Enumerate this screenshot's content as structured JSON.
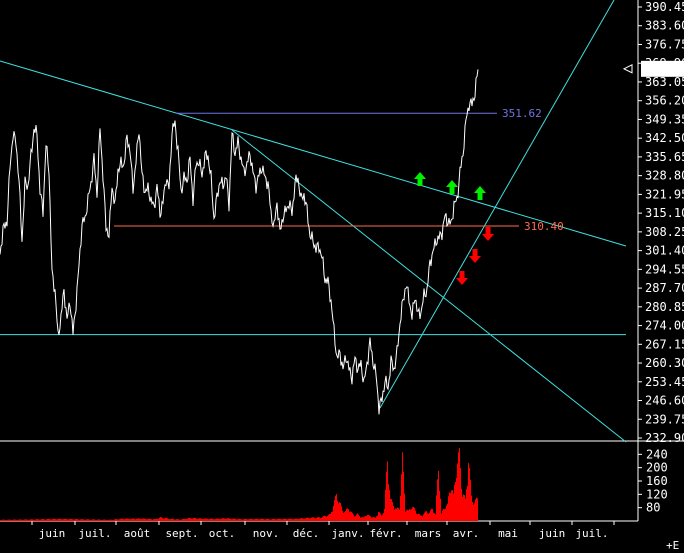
{
  "chart_data": {
    "type": "line",
    "last_price": "367.85",
    "y_ticks": [
      "390.45",
      "383.60",
      "376.75",
      "369.90",
      "363.05",
      "356.20",
      "349.35",
      "342.50",
      "335.65",
      "328.80",
      "321.95",
      "315.10",
      "308.25",
      "301.40",
      "294.55",
      "287.70",
      "280.85",
      "274.00",
      "267.15",
      "260.30",
      "253.45",
      "246.60",
      "239.75",
      "232.90"
    ],
    "ylim": [
      232.9,
      390.45
    ],
    "x_ticks": [
      "juin",
      "juil.",
      "août",
      "sept.",
      "oct.",
      "nov.",
      "déc.",
      "janv.",
      "févr.",
      "mars",
      "avr.",
      "mai",
      "juin",
      "juil."
    ],
    "volume_ticks": [
      "240",
      "200",
      "160",
      "120",
      "80"
    ],
    "volume_ylim": [
      40,
      265
    ],
    "volume_unit": "+E",
    "levels": [
      {
        "label": "351.62",
        "value": 351.62,
        "color": "#6f74e6"
      },
      {
        "label": "310.40",
        "value": 310.4,
        "color": "#ff6a4c"
      },
      {
        "label": "",
        "value": 270.7,
        "color": "#40e0e0"
      }
    ],
    "colors": {
      "price": "#ffffff",
      "trendline": "#40e0e0",
      "volume": "#ff0000",
      "up_arrow": "#00ee00",
      "down_arrow": "#ff0000",
      "axis": "#ffffff"
    },
    "price_anchors": [
      [
        0,
        300
      ],
      [
        3,
        309
      ],
      [
        7,
        312
      ],
      [
        10,
        332
      ],
      [
        13,
        344
      ],
      [
        16,
        341
      ],
      [
        19,
        327
      ],
      [
        22,
        305
      ],
      [
        25,
        326
      ],
      [
        28,
        325
      ],
      [
        31,
        336
      ],
      [
        34,
        346
      ],
      [
        37,
        344
      ],
      [
        40,
        323
      ],
      [
        43,
        316
      ],
      [
        46,
        340
      ],
      [
        49,
        331
      ],
      [
        52,
        293
      ],
      [
        55,
        287
      ],
      [
        58,
        270
      ],
      [
        61,
        277
      ],
      [
        64,
        287
      ],
      [
        67,
        276
      ],
      [
        70,
        283
      ],
      [
        73,
        271
      ],
      [
        76,
        282
      ],
      [
        79,
        296
      ],
      [
        82,
        311
      ],
      [
        85,
        313
      ],
      [
        88,
        320
      ],
      [
        91,
        326
      ],
      [
        94,
        335
      ],
      [
        97,
        322
      ],
      [
        100,
        346
      ],
      [
        103,
        329
      ],
      [
        106,
        310
      ],
      [
        109,
        307
      ],
      [
        112,
        325
      ],
      [
        115,
        318
      ],
      [
        118,
        331
      ],
      [
        121,
        333
      ],
      [
        124,
        333
      ],
      [
        127,
        343
      ],
      [
        130,
        338
      ],
      [
        133,
        324
      ],
      [
        136,
        334
      ],
      [
        139,
        346
      ],
      [
        142,
        329
      ],
      [
        145,
        323
      ],
      [
        148,
        324
      ],
      [
        151,
        320
      ],
      [
        154,
        317
      ],
      [
        157,
        325
      ],
      [
        160,
        315
      ],
      [
        163,
        319
      ],
      [
        166,
        328
      ],
      [
        169,
        324
      ],
      [
        172,
        345
      ],
      [
        175,
        348
      ],
      [
        178,
        338
      ],
      [
        181,
        323
      ],
      [
        184,
        328
      ],
      [
        187,
        327
      ],
      [
        190,
        335
      ],
      [
        193,
        320
      ],
      [
        196,
        333
      ],
      [
        199,
        334
      ],
      [
        202,
        329
      ],
      [
        205,
        336
      ],
      [
        208,
        336
      ],
      [
        211,
        328
      ],
      [
        214,
        313
      ],
      [
        217,
        321
      ],
      [
        220,
        327
      ],
      [
        223,
        325
      ],
      [
        226,
        329
      ],
      [
        229,
        318
      ],
      [
        232,
        344
      ],
      [
        235,
        337
      ],
      [
        238,
        341
      ],
      [
        241,
        335
      ],
      [
        244,
        330
      ],
      [
        247,
        333
      ],
      [
        250,
        337
      ],
      [
        253,
        330
      ],
      [
        256,
        325
      ],
      [
        259,
        329
      ],
      [
        262,
        332
      ],
      [
        265,
        328
      ],
      [
        268,
        326
      ],
      [
        271,
        315
      ],
      [
        274,
        310
      ],
      [
        277,
        319
      ],
      [
        280,
        308
      ],
      [
        283,
        314
      ],
      [
        286,
        316
      ],
      [
        289,
        319
      ],
      [
        292,
        315
      ],
      [
        295,
        326
      ],
      [
        298,
        328
      ],
      [
        301,
        320
      ],
      [
        304,
        322
      ],
      [
        307,
        316
      ],
      [
        310,
        307
      ],
      [
        313,
        305
      ],
      [
        316,
        302
      ],
      [
        319,
        303
      ],
      [
        322,
        299
      ],
      [
        325,
        291
      ],
      [
        328,
        290
      ],
      [
        331,
        283
      ],
      [
        334,
        272
      ],
      [
        337,
        262
      ],
      [
        340,
        264
      ],
      [
        343,
        258
      ],
      [
        346,
        263
      ],
      [
        349,
        258
      ],
      [
        352,
        255
      ],
      [
        355,
        262
      ],
      [
        358,
        258
      ],
      [
        361,
        260
      ],
      [
        364,
        253
      ],
      [
        367,
        260
      ],
      [
        370,
        268
      ],
      [
        373,
        261
      ],
      [
        376,
        256
      ],
      [
        379,
        244
      ],
      [
        382,
        247
      ],
      [
        385,
        254
      ],
      [
        388,
        251
      ],
      [
        391,
        261
      ],
      [
        394,
        258
      ],
      [
        397,
        264
      ],
      [
        400,
        275
      ],
      [
        403,
        283
      ],
      [
        406,
        289
      ],
      [
        409,
        284
      ],
      [
        412,
        277
      ],
      [
        415,
        285
      ],
      [
        418,
        278
      ],
      [
        421,
        279
      ],
      [
        424,
        285
      ],
      [
        427,
        287
      ],
      [
        430,
        297
      ],
      [
        433,
        301
      ],
      [
        436,
        305
      ],
      [
        439,
        306
      ],
      [
        442,
        308
      ],
      [
        445,
        314
      ],
      [
        448,
        312
      ],
      [
        451,
        311
      ],
      [
        454,
        318
      ],
      [
        457,
        320
      ],
      [
        460,
        330
      ],
      [
        463,
        337
      ],
      [
        466,
        349
      ],
      [
        469,
        355
      ],
      [
        472,
        355
      ],
      [
        475,
        359
      ],
      [
        478,
        368
      ]
    ],
    "volume_anchors": [
      [
        0,
        44
      ],
      [
        30,
        45
      ],
      [
        60,
        47
      ],
      [
        90,
        45
      ],
      [
        110,
        44
      ],
      [
        120,
        47
      ],
      [
        140,
        48
      ],
      [
        155,
        46
      ],
      [
        160,
        52
      ],
      [
        170,
        47
      ],
      [
        180,
        45
      ],
      [
        190,
        50
      ],
      [
        200,
        48
      ],
      [
        215,
        47
      ],
      [
        225,
        49
      ],
      [
        240,
        46
      ],
      [
        260,
        47
      ],
      [
        270,
        46
      ],
      [
        280,
        47
      ],
      [
        295,
        47
      ],
      [
        310,
        51
      ],
      [
        320,
        52
      ],
      [
        330,
        62
      ],
      [
        333,
        93
      ],
      [
        336,
        128
      ],
      [
        339,
        103
      ],
      [
        342,
        76
      ],
      [
        345,
        72
      ],
      [
        348,
        84
      ],
      [
        351,
        68
      ],
      [
        354,
        58
      ],
      [
        357,
        63
      ],
      [
        360,
        55
      ],
      [
        363,
        51
      ],
      [
        366,
        62
      ],
      [
        369,
        57
      ],
      [
        372,
        54
      ],
      [
        375,
        50
      ],
      [
        378,
        72
      ],
      [
        381,
        58
      ],
      [
        384,
        80
      ],
      [
        387,
        246
      ],
      [
        390,
        110
      ],
      [
        393,
        96
      ],
      [
        396,
        78
      ],
      [
        399,
        86
      ],
      [
        402,
        247
      ],
      [
        405,
        82
      ],
      [
        408,
        72
      ],
      [
        411,
        90
      ],
      [
        414,
        80
      ],
      [
        417,
        66
      ],
      [
        420,
        58
      ],
      [
        423,
        63
      ],
      [
        426,
        72
      ],
      [
        429,
        68
      ],
      [
        432,
        82
      ],
      [
        435,
        62
      ],
      [
        438,
        227
      ],
      [
        441,
        63
      ],
      [
        444,
        88
      ],
      [
        447,
        92
      ],
      [
        450,
        166
      ],
      [
        453,
        122
      ],
      [
        456,
        223
      ],
      [
        459,
        262
      ],
      [
        462,
        133
      ],
      [
        465,
        110
      ],
      [
        468,
        246
      ],
      [
        471,
        123
      ],
      [
        474,
        99
      ],
      [
        477,
        118
      ]
    ]
  },
  "icons": {
    "up_arrow": "up-arrow-icon",
    "down_arrow": "down-arrow-icon",
    "price_pointer": "price-pointer-icon"
  }
}
